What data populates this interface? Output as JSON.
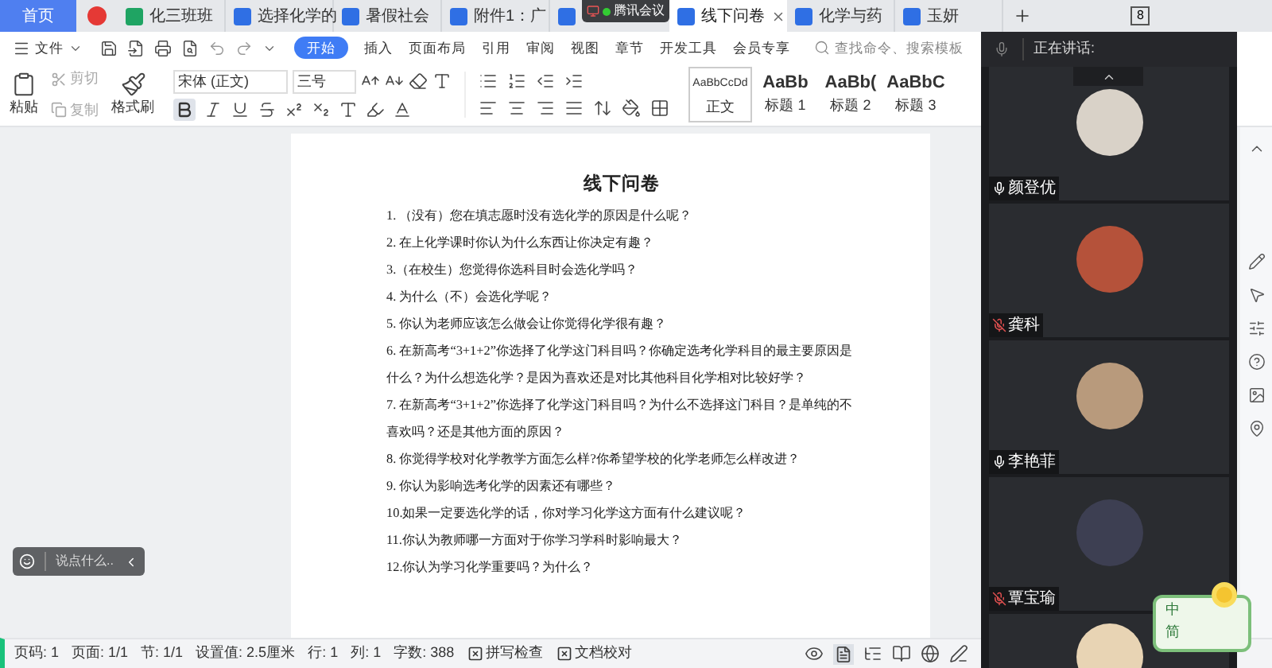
{
  "tabs": [
    {
      "label": "首页",
      "kind": "home",
      "selected": false
    },
    {
      "kind": "logo",
      "selected": false
    },
    {
      "label": "化三班班",
      "kind": "sheet",
      "selected": false
    },
    {
      "label": "选择化学的",
      "kind": "doc",
      "selected": false
    },
    {
      "label": "暑假社会",
      "kind": "doc",
      "selected": false
    },
    {
      "label": "附件1：广",
      "kind": "doc",
      "selected": false
    },
    {
      "kind": "doc",
      "selected": false
    },
    {
      "label": "线下问卷",
      "kind": "doc",
      "selected": true
    },
    {
      "label": "化学与药",
      "kind": "doc",
      "selected": false
    },
    {
      "label": "玉妍",
      "kind": "doc",
      "selected": false
    }
  ],
  "meeting_badge": "腾讯会议",
  "window_controls": {
    "screen_count": "8"
  },
  "menu": {
    "file": "文件",
    "items": [
      {
        "label": "开始",
        "selected": true
      },
      {
        "label": "插入",
        "selected": false
      },
      {
        "label": "页面布局",
        "selected": false
      },
      {
        "label": "引用",
        "selected": false
      },
      {
        "label": "审阅",
        "selected": false
      },
      {
        "label": "视图",
        "selected": false
      },
      {
        "label": "章节",
        "selected": false
      },
      {
        "label": "开发工具",
        "selected": false
      },
      {
        "label": "会员专享",
        "selected": false
      }
    ],
    "search": {
      "placeholder": "查找命令、搜索模板"
    }
  },
  "ribbon": {
    "paste": "粘贴",
    "cut": "剪切",
    "copy": "复制",
    "format_painter": "格式刷",
    "font": "宋体 (正文)",
    "size": "三号",
    "bold_on": true,
    "styles": [
      {
        "preview": "AaBbCcDd",
        "name": "正文",
        "selected": true
      },
      {
        "preview": "AaBb",
        "name": "标题 1",
        "selected": false
      },
      {
        "preview": "AaBb(",
        "name": "标题 2",
        "selected": false
      },
      {
        "preview": "AaBbC",
        "name": "标题 3",
        "selected": false
      }
    ]
  },
  "document": {
    "title": "线下问卷",
    "questions": [
      "1. （没有）您在填志愿时没有选化学的原因是什么呢？",
      "2. 在上化学课时你认为什么东西让你决定有趣？",
      "3.（在校生）您觉得你选科目时会选化学吗？",
      "4. 为什么（不）会选化学呢？",
      "5. 你认为老师应该怎么做会让你觉得化学很有趣？",
      "6. 在新高考“3+1+2”你选择了化学这门科目吗？你确定选考化学科目的最主要原因是什么？为什么想选化学？是因为喜欢还是对比其他科目化学相对比较好学？",
      "7. 在新高考“3+1+2”你选择了化学这门科目吗？为什么不选择这门科目？是单纯的不喜欢吗？还是其他方面的原因？",
      "8. 你觉得学校对化学教学方面怎么样?你希望学校的化学老师怎么样改进？",
      "9. 你认为影响选考化学的因素还有哪些？",
      "10.如果一定要选化学的话，你对学习化学这方面有什么建议呢？",
      "11.你认为教师哪一方面对于你学习学科时影响最大？",
      "12.你认为学习化学重要吗？为什么？"
    ]
  },
  "chat_input": {
    "placeholder": "说点什么..."
  },
  "status_bar": {
    "items": [
      "页码: 1",
      "页面: 1/1",
      "节: 1/1",
      "设置值: 2.5厘米",
      "行: 1",
      "列: 1",
      "字数: 388"
    ],
    "spell_check": "拼写检查",
    "proofread": "文档校对"
  },
  "meeting": {
    "speaking_label": "正在讲话:",
    "participants": [
      {
        "name": "颜登优",
        "muted": false
      },
      {
        "name": "龚科",
        "muted": true
      },
      {
        "name": "李艳菲",
        "muted": false
      },
      {
        "name": "覃宝瑜",
        "muted": true
      }
    ]
  },
  "ime": {
    "mode": "中",
    "script": "简"
  }
}
